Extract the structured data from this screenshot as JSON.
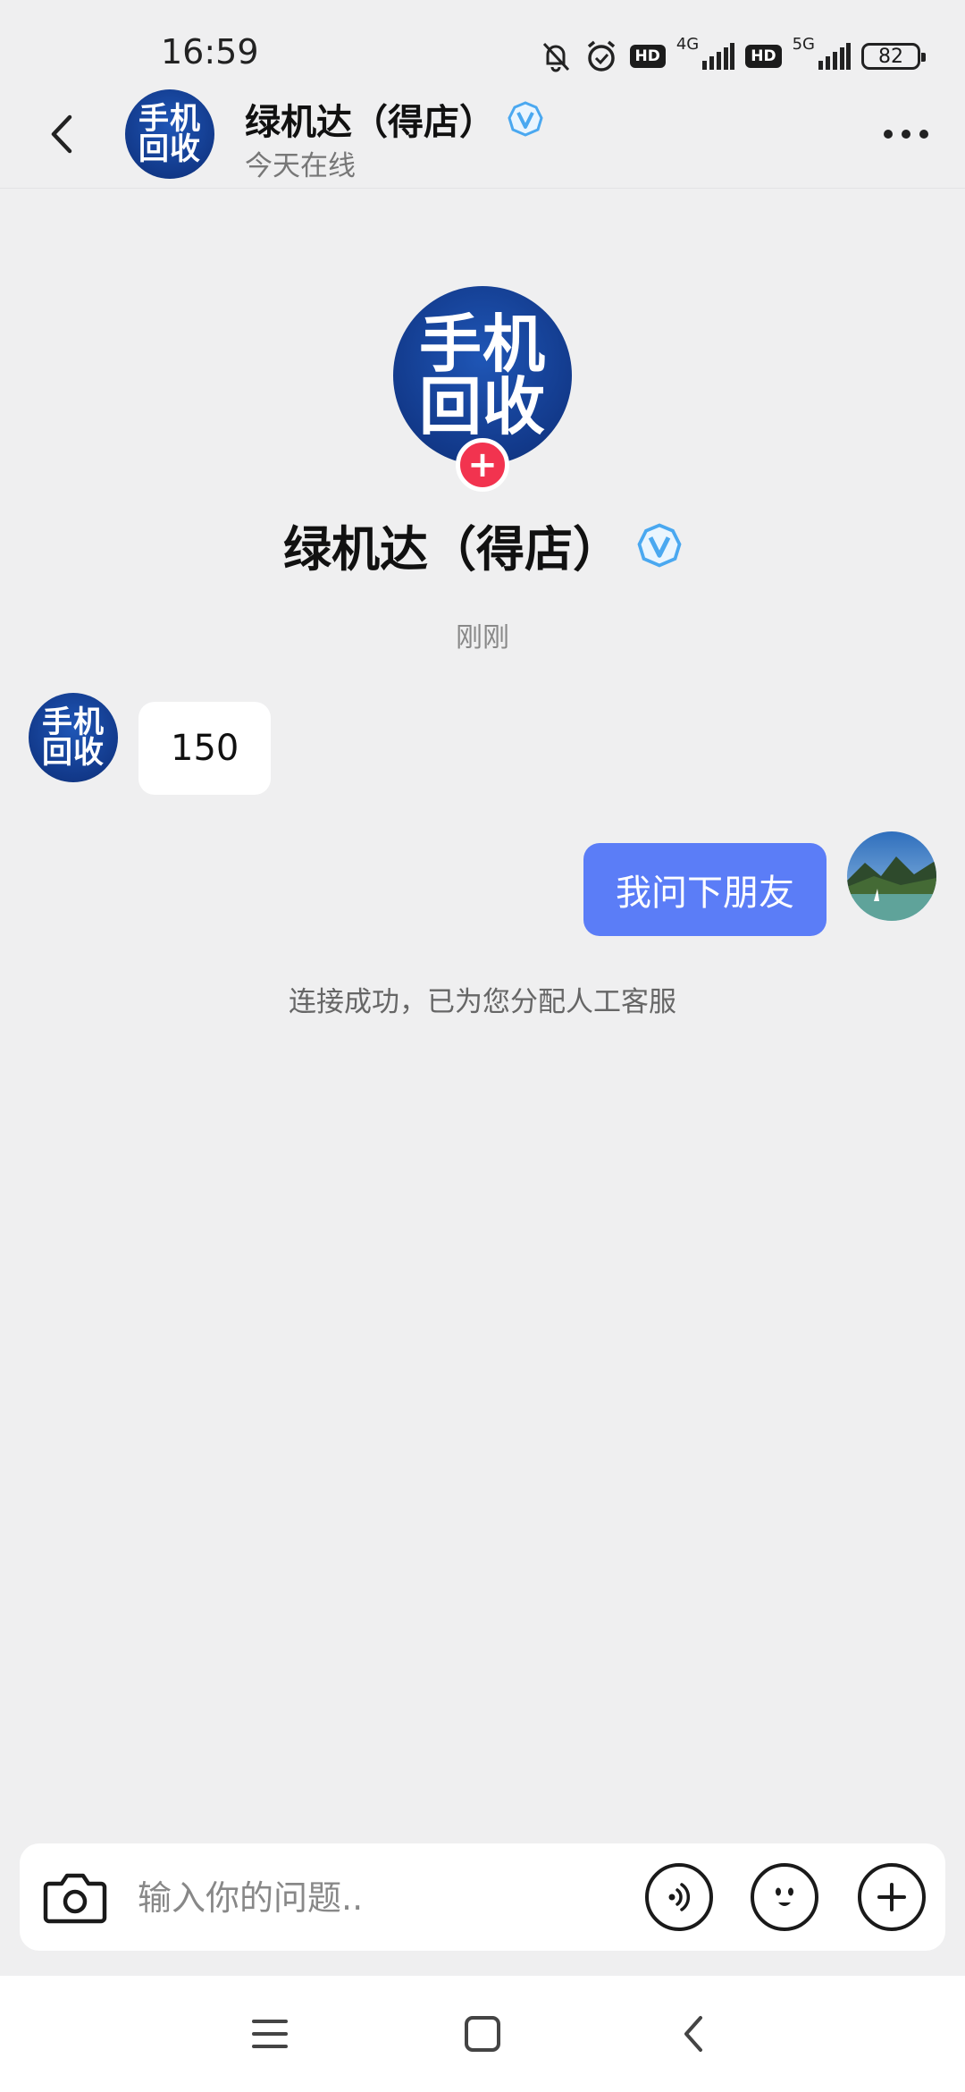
{
  "status_bar": {
    "time": "16:59",
    "net1_label": "4G",
    "net2_label": "5G",
    "hd1": "HD",
    "hd2": "HD",
    "battery": "82"
  },
  "header": {
    "title": "绿机达（得店）",
    "subtitle": "今天在线",
    "avatar_line1": "手机",
    "avatar_line2": "回收"
  },
  "profile": {
    "name": "绿机达（得店）",
    "avatar_line1": "手机",
    "avatar_line2": "回收",
    "follow_symbol": "+"
  },
  "chat": {
    "timestamp": "刚刚",
    "messages": [
      {
        "side": "left",
        "text": "150",
        "avatar_line1": "手机",
        "avatar_line2": "回收"
      },
      {
        "side": "right",
        "text": "我问下朋友"
      }
    ],
    "system_notice": "连接成功，已为您分配人工客服"
  },
  "input": {
    "placeholder": "输入你的问题.."
  },
  "colors": {
    "background": "#efeff0",
    "bubble_right": "#5b7df7",
    "bubble_left": "#ffffff",
    "verified": "#4aa8f0",
    "follow_badge": "#f2334f",
    "logo_blue": "#12398a"
  },
  "icons": {
    "back": "chevron-left-icon",
    "more": "more-dots-icon",
    "verified": "verified-badge-icon",
    "camera": "camera-icon",
    "voice": "voice-icon",
    "emoji": "emoji-icon",
    "plus": "plus-icon",
    "nav_menu": "menu-icon",
    "nav_home": "home-square-icon",
    "nav_back": "nav-back-icon"
  }
}
